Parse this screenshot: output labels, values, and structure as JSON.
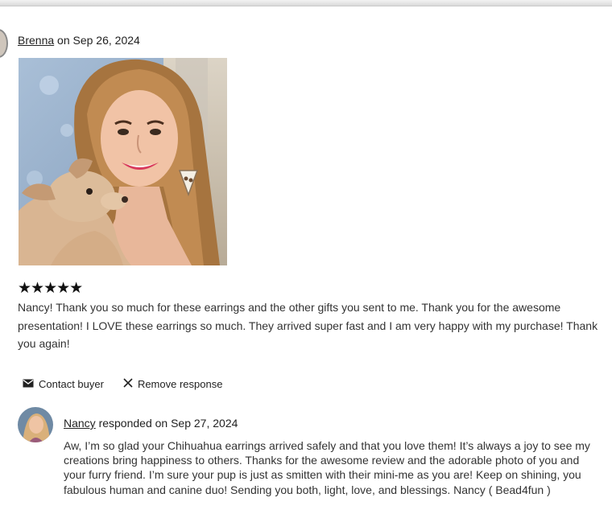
{
  "review": {
    "reviewer_name": "Brenna",
    "date_text": " on Sep 26, 2024",
    "photo_alt": "Photo from Brenna",
    "stars": "★★★★★",
    "rating": 5,
    "text": "Nancy! Thank you so much for these earrings and the other gifts you sent to me. Thank you for the awesome presentation! I LOVE these earrings so much. They arrived super fast and I am very happy with my purchase! Thank you again!"
  },
  "actions": {
    "contact_label": "Contact buyer",
    "contact_icon": "envelope-icon",
    "remove_label": "Remove response",
    "remove_icon": "close-icon"
  },
  "response": {
    "responder_name": "Nancy",
    "date_text": " responded on Sep 27, 2024",
    "text": "Aw, I’m so glad your Chihuahua earrings arrived safely and that you love them! It’s always a joy to see my creations bring happiness to others. Thanks for the awesome review and the adorable photo of you and your furry friend. I’m sure your pup is just as smitten with their mini-me as you are! Keep on shining, you fabulous human and canine duo! Sending you both, light, love, and blessings. Nancy ( Bead4fun )"
  },
  "colors": {
    "text": "#222222",
    "muted_text": "#333333",
    "stars": "#111111"
  }
}
